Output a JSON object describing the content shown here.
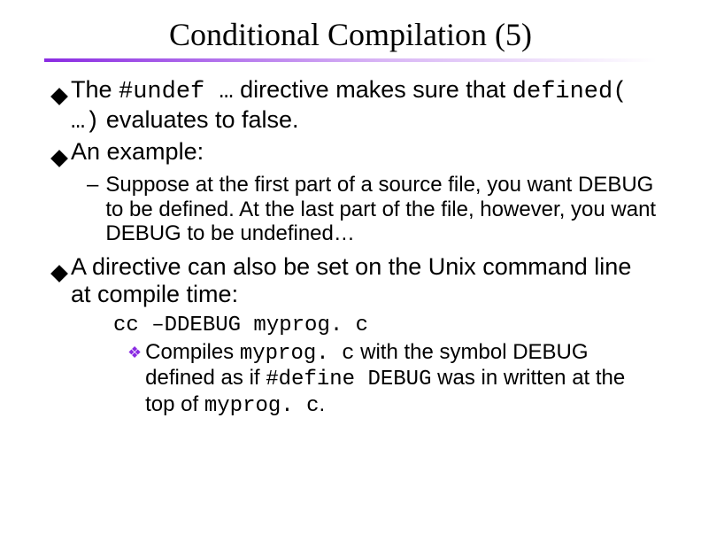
{
  "title": "Conditional Compilation (5)",
  "bullets": {
    "b1_pre": "The ",
    "b1_code": "#undef …",
    "b1_mid": " directive makes sure that ",
    "b1_code2": "defined( …)",
    "b1_post": " evaluates to false.",
    "b2": "An example:",
    "b2_sub": "Suppose at the first part of a source file, you want DEBUG to be defined.  At the last part of the file, however, you want DEBUG to be undefined…",
    "b3": "A directive can also be set on the Unix command line at compile time:",
    "b3_code": "cc –DDEBUG myprog. c",
    "b3_sub_pre": "Compiles ",
    "b3_sub_c1": "myprog. c",
    "b3_sub_mid": " with the symbol DEBUG defined as if ",
    "b3_sub_c2": "#define DEBUG",
    "b3_sub_mid2": " was in written at the top of ",
    "b3_sub_c3": "myprog. c",
    "b3_sub_post": "."
  }
}
